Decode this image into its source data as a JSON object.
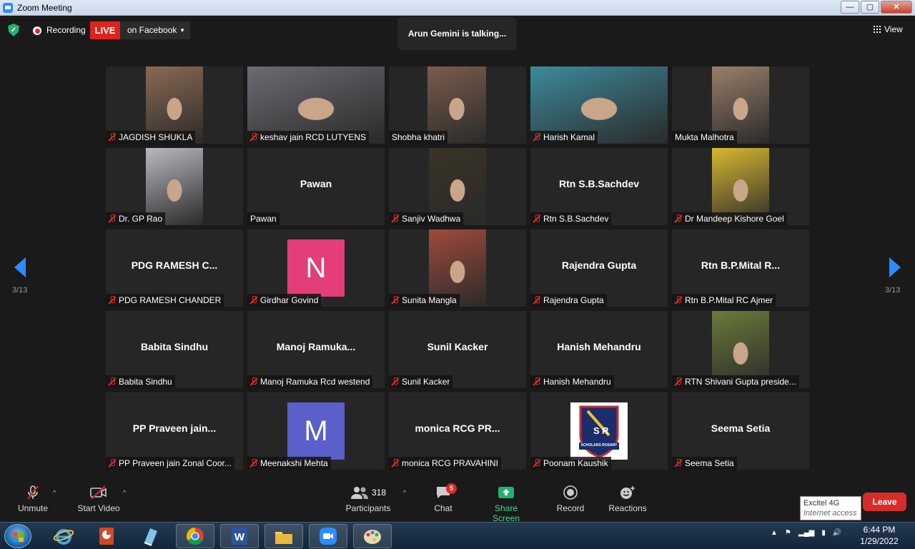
{
  "window": {
    "title": "Zoom Meeting",
    "controls": [
      "—",
      "▢",
      "✕"
    ]
  },
  "topbar": {
    "recording_label": "Recording",
    "live_label": "LIVE",
    "live_target": "on Facebook",
    "talking": "Arun Gemini is talking...",
    "view_label": "View"
  },
  "pager": {
    "left": "3/13",
    "right": "3/13"
  },
  "participants": [
    {
      "label": "JAGDISH SHUKLA",
      "kind": "video",
      "muted": true,
      "photo_bg": "#8a6a52"
    },
    {
      "label": "keshav jain RCD LUTYENS",
      "kind": "video",
      "muted": true,
      "photo_bg": "#6b6b72"
    },
    {
      "label": "Shobha khatri",
      "kind": "video",
      "muted": false,
      "photo_bg": "#7a5c4c"
    },
    {
      "label": "Harish Kamal",
      "kind": "video",
      "muted": true,
      "photo_bg": "#3d8a9a"
    },
    {
      "label": "Mukta Malhotra",
      "kind": "video",
      "muted": false,
      "photo_bg": "#9a7f6a"
    },
    {
      "label": "Dr. GP Rao",
      "kind": "video",
      "muted": true,
      "photo_bg": "#b9b9c2"
    },
    {
      "label": "Pawan",
      "kind": "name",
      "muted": false,
      "big": "Pawan"
    },
    {
      "label": "Sanjiv Wadhwa",
      "kind": "video",
      "muted": true,
      "photo_bg": "#3a3326"
    },
    {
      "label": "Rtn S.B.Sachdev",
      "kind": "name",
      "muted": true,
      "big": "Rtn S.B.Sachdev"
    },
    {
      "label": "Dr Mandeep Kishore Goel",
      "kind": "video",
      "muted": true,
      "photo_bg": "#d8b830"
    },
    {
      "label": "PDG RAMESH CHANDER",
      "kind": "name",
      "muted": true,
      "big": "PDG RAMESH  C..."
    },
    {
      "label": "Girdhar Govind",
      "kind": "avatar",
      "muted": true,
      "letter": "N",
      "avatar_bg": "#e33d7a"
    },
    {
      "label": "Sunita Mangla",
      "kind": "video",
      "muted": true,
      "photo_bg": "#a04a3c"
    },
    {
      "label": "Rajendra Gupta",
      "kind": "name",
      "muted": true,
      "big": "Rajendra Gupta"
    },
    {
      "label": "Rtn B.P.Mital RC Ajmer",
      "kind": "name",
      "muted": true,
      "big": "Rtn  B.P.Mital  R..."
    },
    {
      "label": "Babita Sindhu",
      "kind": "name",
      "muted": true,
      "big": "Babita Sindhu"
    },
    {
      "label": "Manoj Ramuka Rcd westend",
      "kind": "name",
      "muted": true,
      "big": "Manoj  Ramuka..."
    },
    {
      "label": "Sunil Kacker",
      "kind": "name",
      "muted": true,
      "big": "Sunil Kacker"
    },
    {
      "label": "Hanish Mehandru",
      "kind": "name",
      "muted": true,
      "big": "Hanish Mehandru"
    },
    {
      "label": "RTN Shivani Gupta preside...",
      "kind": "video",
      "muted": true,
      "photo_bg": "#6a7a3a"
    },
    {
      "label": "PP Praveen jain Zonal Coor...",
      "kind": "name",
      "muted": true,
      "big": "PP  Praveen  jain..."
    },
    {
      "label": "Meenakshi Mehta",
      "kind": "avatar",
      "muted": true,
      "letter": "M",
      "avatar_bg": "#5a5fc9"
    },
    {
      "label": "monica RCG PRAVAHINI",
      "kind": "name",
      "muted": true,
      "big": "monica  RCG  PR..."
    },
    {
      "label": "Poonam Kaushik",
      "kind": "logo",
      "muted": true,
      "logo_text": "SCHOLARS ROSARY",
      "logo_letters": "SR"
    },
    {
      "label": "Seema Setia",
      "kind": "name",
      "muted": true,
      "big": "Seema Setia"
    }
  ],
  "toolbar": {
    "unmute": "Unmute",
    "start_video": "Start Video",
    "participants_label": "Participants",
    "participants_count": "318",
    "chat": "Chat",
    "chat_badge": "5",
    "share": "Share Screen",
    "record": "Record",
    "reactions": "Reactions",
    "leave": "Leave"
  },
  "tooltip": {
    "line1": "Excitel 4G",
    "line2": "Internet access"
  },
  "taskbar": {
    "time": "6:44 PM",
    "date": "1/29/2022"
  },
  "colors": {
    "accent": "#2d8cff",
    "danger": "#e02828",
    "share_green": "#23b26d",
    "tile": "#262626"
  }
}
